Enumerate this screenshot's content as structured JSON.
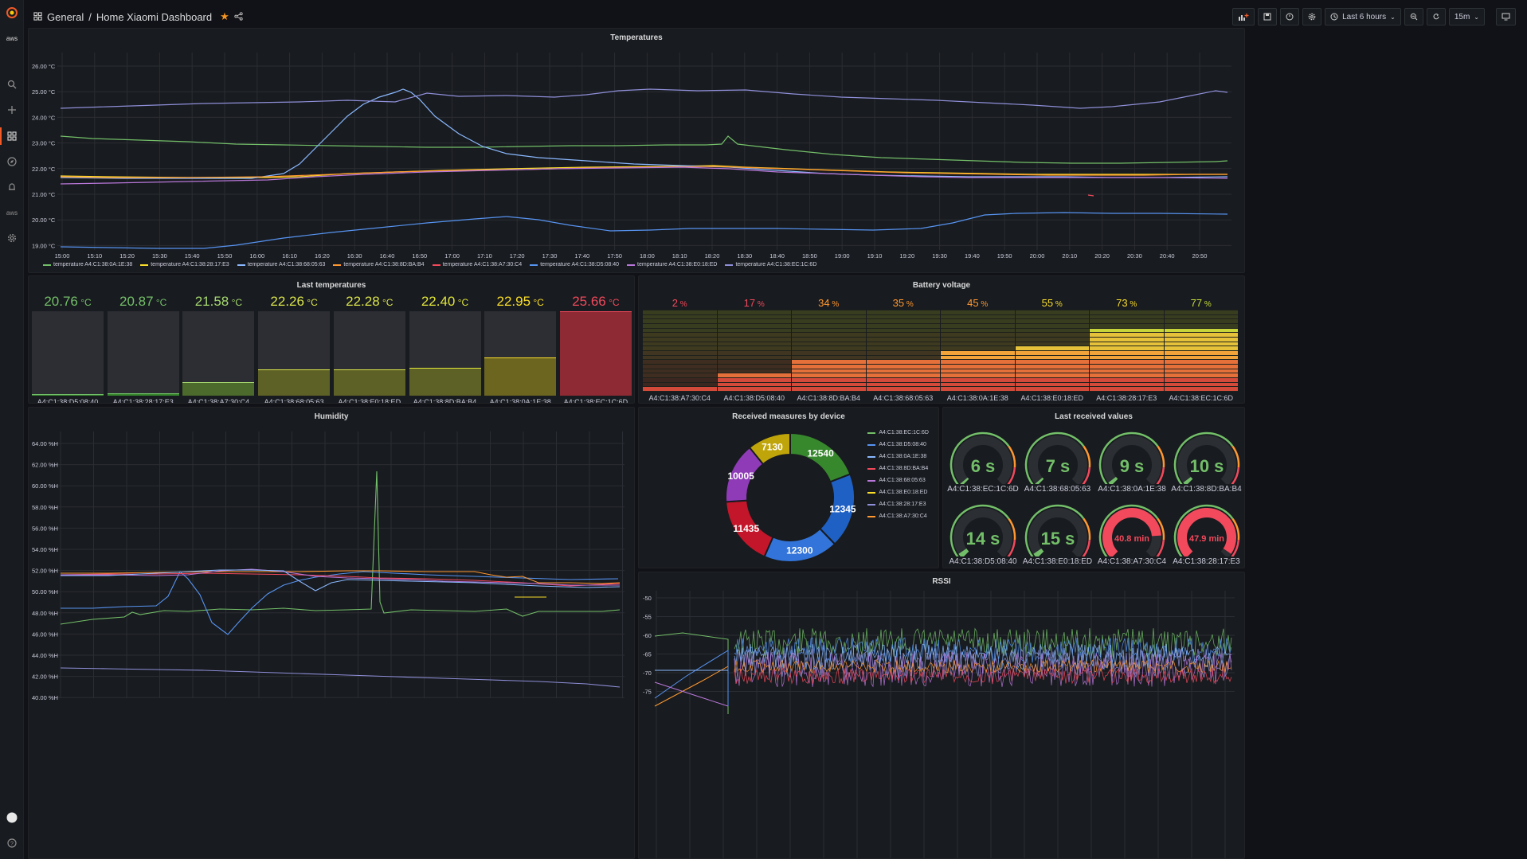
{
  "nav": {
    "breadcrumb_folder": "General",
    "breadcrumb_sep": "/",
    "breadcrumb_title": "Home Xiaomi Dashboard",
    "time_range": "Last 6 hours",
    "refresh_interval": "15m",
    "sidebar_icons": [
      "grafana-logo-icon",
      "aws-icon",
      "search-icon",
      "plus-icon",
      "dashboards-icon",
      "explore-icon",
      "alert-bell-icon",
      "aws-icon",
      "gear-icon",
      "user-avatar-icon",
      "help-icon"
    ]
  },
  "temperatures": {
    "title": "Temperatures",
    "y_ticks": [
      "26.00 °C",
      "25.00 °C",
      "24.00 °C",
      "23.00 °C",
      "22.00 °C",
      "21.00 °C",
      "20.00 °C",
      "19.00 °C"
    ],
    "x_ticks": [
      "15:00",
      "15:10",
      "15:20",
      "15:30",
      "15:40",
      "15:50",
      "16:00",
      "16:10",
      "16:20",
      "16:30",
      "16:40",
      "16:50",
      "17:00",
      "17:10",
      "17:20",
      "17:30",
      "17:40",
      "17:50",
      "18:00",
      "18:10",
      "18:20",
      "18:30",
      "18:40",
      "18:50",
      "19:00",
      "19:10",
      "19:20",
      "19:30",
      "19:40",
      "19:50",
      "20:00",
      "20:10",
      "20:20",
      "20:30",
      "20:40",
      "20:50"
    ],
    "legend": [
      {
        "label": "temperature A4:C1:38:0A:1E:38",
        "color": "#73bf69"
      },
      {
        "label": "temperature A4:C1:38:28:17:E3",
        "color": "#fade2a"
      },
      {
        "label": "temperature A4:C1:38:68:05:63",
        "color": "#8ab8ff"
      },
      {
        "label": "temperature A4:C1:38:8D:BA:B4",
        "color": "#ff9830"
      },
      {
        "label": "temperature A4:C1:38:A7:30:C4",
        "color": "#f2495c"
      },
      {
        "label": "temperature A4:C1:38:D5:08:40",
        "color": "#5794f2"
      },
      {
        "label": "temperature A4:C1:38:E0:18:ED",
        "color": "#b877d9"
      },
      {
        "label": "temperature A4:C1:38:EC:1C:6D",
        "color": "#8f8fd9"
      }
    ]
  },
  "last_temperatures": {
    "title": "Last temperatures",
    "unit": "°C",
    "items": [
      {
        "value": "20.76",
        "label": "A4:C1:38:D5:08:40",
        "fill": 0.02,
        "color": "#73bf69",
        "bar": "#37872d"
      },
      {
        "value": "20.87",
        "label": "A4:C1:38:28:17:E3",
        "fill": 0.03,
        "color": "#73bf69",
        "bar": "#37872d"
      },
      {
        "value": "21.58",
        "label": "A4:C1:38:A7:30:C4",
        "fill": 0.16,
        "color": "#a5d86f",
        "bar": "#4b6a2c"
      },
      {
        "value": "22.26",
        "label": "A4:C1:38:68:05:63",
        "fill": 0.31,
        "color": "#d9e34b",
        "bar": "#5e6125"
      },
      {
        "value": "22.28",
        "label": "A4:C1:38:E0:18:ED",
        "fill": 0.31,
        "color": "#d9e34b",
        "bar": "#5e6125"
      },
      {
        "value": "22.40",
        "label": "A4:C1:38:8D:BA:B4",
        "fill": 0.33,
        "color": "#e0e53b",
        "bar": "#5e6125"
      },
      {
        "value": "22.95",
        "label": "A4:C1:38:0A:1E:38",
        "fill": 0.45,
        "color": "#fade2a",
        "bar": "#6b6520"
      },
      {
        "value": "25.66",
        "label": "A4:C1:38:EC:1C:6D",
        "fill": 1.0,
        "color": "#f2495c",
        "bar": "#8e2a33"
      }
    ]
  },
  "battery": {
    "title": "Battery voltage",
    "unit": "%",
    "items": [
      {
        "value": "2",
        "label": "A4:C1:38:A7:30:C4",
        "color": "#f2495c"
      },
      {
        "value": "17",
        "label": "A4:C1:38:D5:08:40",
        "color": "#f2495c"
      },
      {
        "value": "34",
        "label": "A4:C1:38:8D:BA:B4",
        "color": "#ff9830"
      },
      {
        "value": "35",
        "label": "A4:C1:38:68:05:63",
        "color": "#ff9830"
      },
      {
        "value": "45",
        "label": "A4:C1:38:0A:1E:38",
        "color": "#ff9830"
      },
      {
        "value": "55",
        "label": "A4:C1:38:E0:18:ED",
        "color": "#fade2a"
      },
      {
        "value": "73",
        "label": "A4:C1:38:28:17:E3",
        "color": "#fade2a"
      },
      {
        "value": "77",
        "label": "A4:C1:38:EC:1C:6D",
        "color": "#c8df3a"
      }
    ]
  },
  "humidity": {
    "title": "Humidity",
    "y_ticks": [
      "64.00 %H",
      "62.00 %H",
      "60.00 %H",
      "58.00 %H",
      "56.00 %H",
      "54.00 %H",
      "52.00 %H",
      "50.00 %H",
      "48.00 %H",
      "46.00 %H",
      "44.00 %H",
      "42.00 %H",
      "40.00 %H"
    ]
  },
  "received": {
    "title": "Received measures by device",
    "slices": [
      {
        "name": "A4:C1:38:EC:1C:6D",
        "value": 12540,
        "label": "12540",
        "color": "#37872d"
      },
      {
        "name": "A4:C1:38:D5:08:40",
        "value": 12345,
        "label": "12345",
        "color": "#1f60c4"
      },
      {
        "name": "A4:C1:38:0A:1E:38",
        "value": 12300,
        "label": "12300",
        "color": "#3274d9"
      },
      {
        "name": "A4:C1:38:8D:BA:B4",
        "value": 11435,
        "label": "11435",
        "color": "#c4162a"
      },
      {
        "name": "A4:C1:38:68:05:63",
        "value": 10005,
        "label": "10005",
        "color": "#8f3bb8"
      },
      {
        "name": "A4:C1:38:E0:18:ED",
        "value": 7130,
        "label": "7130",
        "color": "#c0a50a"
      }
    ],
    "legend": [
      {
        "label": "A4:C1:38:EC:1C:6D",
        "color": "#73bf69"
      },
      {
        "label": "A4:C1:38:D5:08:40",
        "color": "#5794f2"
      },
      {
        "label": "A4:C1:38:0A:1E:38",
        "color": "#8ab8ff"
      },
      {
        "label": "A4:C1:38:8D:BA:B4",
        "color": "#f2495c"
      },
      {
        "label": "A4:C1:38:68:05:63",
        "color": "#b877d9"
      },
      {
        "label": "A4:C1:38:E0:18:ED",
        "color": "#fade2a"
      },
      {
        "label": "A4:C1:38:28:17:E3",
        "color": "#8f8fd9"
      },
      {
        "label": "A4:C1:38:A7:30:C4",
        "color": "#ff9830"
      }
    ]
  },
  "last_received": {
    "title": "Last received values",
    "gauges": [
      {
        "value": "6",
        "unit": "s",
        "label": "A4:C1:38:EC:1C:6D",
        "fill": 0.02,
        "color": "#73bf69"
      },
      {
        "value": "7",
        "unit": "s",
        "label": "A4:C1:38:68:05:63",
        "fill": 0.02,
        "color": "#73bf69"
      },
      {
        "value": "9",
        "unit": "s",
        "label": "A4:C1:38:0A:1E:38",
        "fill": 0.03,
        "color": "#73bf69"
      },
      {
        "value": "10",
        "unit": "s",
        "label": "A4:C1:38:8D:BA:B4",
        "fill": 0.03,
        "color": "#73bf69"
      },
      {
        "value": "14",
        "unit": "s",
        "label": "A4:C1:38:D5:08:40",
        "fill": 0.04,
        "color": "#73bf69"
      },
      {
        "value": "15",
        "unit": "s",
        "label": "A4:C1:38:E0:18:ED",
        "fill": 0.04,
        "color": "#73bf69"
      },
      {
        "value": "40.8",
        "unit": "min",
        "label": "A4:C1:38:A7:30:C4",
        "fill": 0.82,
        "color": "#f2495c"
      },
      {
        "value": "47.9",
        "unit": "min",
        "label": "A4:C1:38:28:17:E3",
        "fill": 0.96,
        "color": "#f2495c"
      }
    ]
  },
  "rssi": {
    "title": "RSSI",
    "y_ticks": [
      "-50",
      "-55",
      "-60",
      "-65",
      "-70",
      "-75"
    ]
  }
}
